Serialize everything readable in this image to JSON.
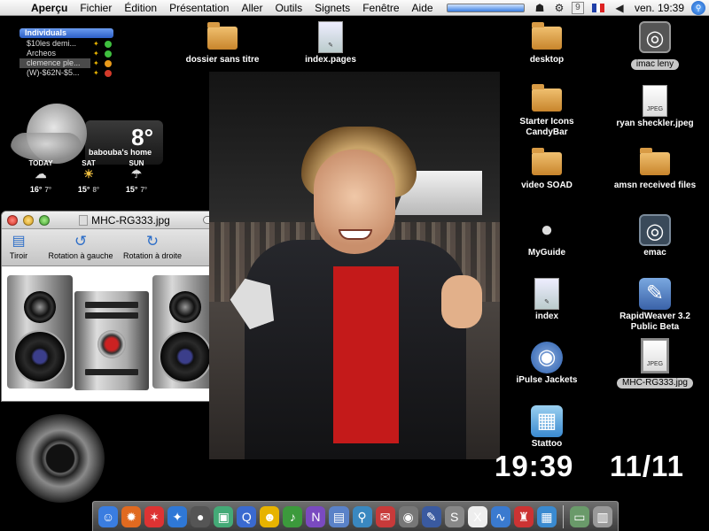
{
  "menubar": {
    "app": "Aperçu",
    "menus": [
      "Fichier",
      "Édition",
      "Présentation",
      "Aller",
      "Outils",
      "Signets",
      "Fenêtre",
      "Aide"
    ],
    "clock": "ven. 19:39",
    "extra_box": "9"
  },
  "buddies": {
    "group": "Individuals",
    "items": [
      {
        "name": "$10les demi...",
        "status_color": "#3fbf3f"
      },
      {
        "name": "Archeos",
        "status_color": "#3fbf3f"
      },
      {
        "name": "clemence ple...",
        "status_color": "#e89a1a"
      },
      {
        "name": "(W)-$62N-$5...",
        "status_color": "#d33a2a"
      }
    ]
  },
  "weather": {
    "temp": "8°",
    "location": "babouba's home",
    "days": [
      {
        "label": "TODAY",
        "hi": "16°",
        "lo": "7°"
      },
      {
        "label": "SAT",
        "hi": "15°",
        "lo": "8°"
      },
      {
        "label": "SUN",
        "hi": "15°",
        "lo": "7°"
      }
    ]
  },
  "preview_window": {
    "title": "MHC-RG333.jpg",
    "toolbar": {
      "drawer": "Tiroir",
      "rotate_left": "Rotation à gauche",
      "rotate_right": "Rotation à droite",
      "more": "»"
    }
  },
  "desktop_icons": [
    {
      "label": "dossier sans titre"
    },
    {
      "label": "index.pages"
    },
    {
      "label": "desktop"
    },
    {
      "label": "imac leny"
    },
    {
      "label": "Starter Icons CandyBar"
    },
    {
      "label": "ryan sheckler.jpeg"
    },
    {
      "label": "video SOAD"
    },
    {
      "label": "amsn received files"
    },
    {
      "label": "MyGuide"
    },
    {
      "label": "emac"
    },
    {
      "label": "index"
    },
    {
      "label": "RapidWeaver 3.2 Public Beta"
    },
    {
      "label": "iPulse Jackets"
    },
    {
      "label": "MHC-RG333.jpg"
    },
    {
      "label": "Stattoo"
    }
  ],
  "file_badge": "JPEG",
  "big_clock": "19:39",
  "big_date": "11/11",
  "dock": {
    "items": [
      {
        "name": "finder-icon",
        "color": "#3a7de0",
        "glyph": "☺"
      },
      {
        "name": "firefox-icon",
        "color": "#e06a20",
        "glyph": "✹"
      },
      {
        "name": "ical-icon",
        "color": "#d33",
        "glyph": "✶"
      },
      {
        "name": "safari-icon",
        "color": "#2f78d6",
        "glyph": "✦"
      },
      {
        "name": "camino-icon",
        "color": "#555",
        "glyph": "●"
      },
      {
        "name": "iphoto-icon",
        "color": "#4a7",
        "glyph": "▣"
      },
      {
        "name": "quicktime-icon",
        "color": "#3a6ad0",
        "glyph": "Q"
      },
      {
        "name": "adium-icon",
        "color": "#e7b300",
        "glyph": "☻"
      },
      {
        "name": "itunes-icon",
        "color": "#3c9a3c",
        "glyph": "♪"
      },
      {
        "name": "nvu-icon",
        "color": "#7a4ac0",
        "glyph": "N"
      },
      {
        "name": "preview-icon",
        "color": "#5a82c8",
        "glyph": "▤"
      },
      {
        "name": "search-icon",
        "color": "#3a88c0",
        "glyph": "⚲"
      },
      {
        "name": "mail-icon",
        "color": "#c83a3a",
        "glyph": "✉"
      },
      {
        "name": "photo-booth-icon",
        "color": "#777",
        "glyph": "◉"
      },
      {
        "name": "pen-icon",
        "color": "#3a5aa0",
        "glyph": "✎"
      },
      {
        "name": "skype-icon",
        "color": "#888",
        "glyph": "S"
      },
      {
        "name": "x11-icon",
        "color": "#eee",
        "glyph": "X"
      },
      {
        "name": "wave-icon",
        "color": "#3a7acf",
        "glyph": "∿"
      },
      {
        "name": "robot-icon",
        "color": "#c33",
        "glyph": "♜"
      },
      {
        "name": "screens-icon",
        "color": "#3a8ad0",
        "glyph": "▦"
      },
      {
        "name": "network-icon",
        "color": "#6a9a6a",
        "glyph": "▭"
      },
      {
        "name": "trash-icon",
        "color": "#999",
        "glyph": "▥"
      }
    ]
  }
}
